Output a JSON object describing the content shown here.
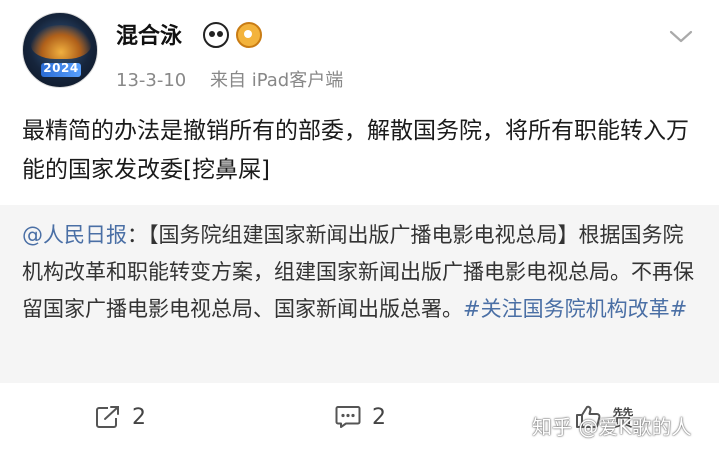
{
  "post": {
    "username": "混合泳",
    "date": "13-3-10",
    "source": "来自 iPad客户端",
    "text": "最精简的办法是撤销所有的部委，解散国务院，将所有职能转入万能的国家发改委[挖鼻屎]",
    "avatar_text": "2024"
  },
  "repost": {
    "mention": "@人民日报",
    "body": "：【国务院组建国家新闻出版广播电影电视总局】根据国务院机构改革和职能转变方案，组建国家新闻出版广播电影电视总局。不再保留国家广播电影电视总局、国家新闻出版总署。",
    "hashtag": "#关注国务院机构改革#"
  },
  "actions": {
    "repost_count": "2",
    "comment_count": "2",
    "like_label": "赞"
  },
  "watermark": "知乎 @爱K歌的人",
  "colors": {
    "link": "#4a6fa5",
    "repost_bg": "#f5f5f5",
    "meta": "#888888"
  }
}
